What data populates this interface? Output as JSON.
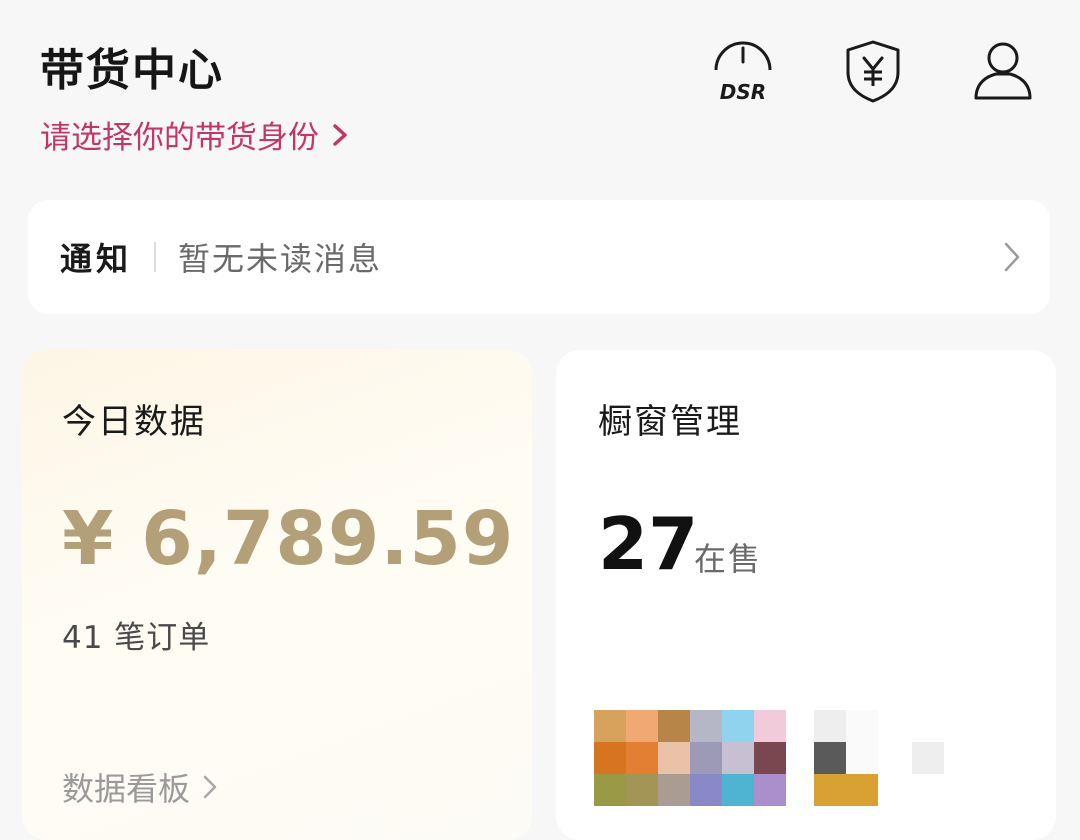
{
  "header": {
    "title": "带货中心",
    "identity_link": "请选择你的带货身份",
    "icons": [
      "dsr-icon",
      "shield-yen-icon",
      "user-icon"
    ],
    "dsr_label": "DSR"
  },
  "notice": {
    "label": "通知",
    "message": "暂无未读消息"
  },
  "today": {
    "title": "今日数据",
    "amount": "¥ 6,789.59",
    "orders": "41 笔订单",
    "board_link": "数据看板"
  },
  "window": {
    "title": "橱窗管理",
    "count": "27",
    "status": "在售"
  },
  "colors": {
    "accent": "#c33766",
    "amount": "#b3a079",
    "background": "#f7f7f7"
  }
}
